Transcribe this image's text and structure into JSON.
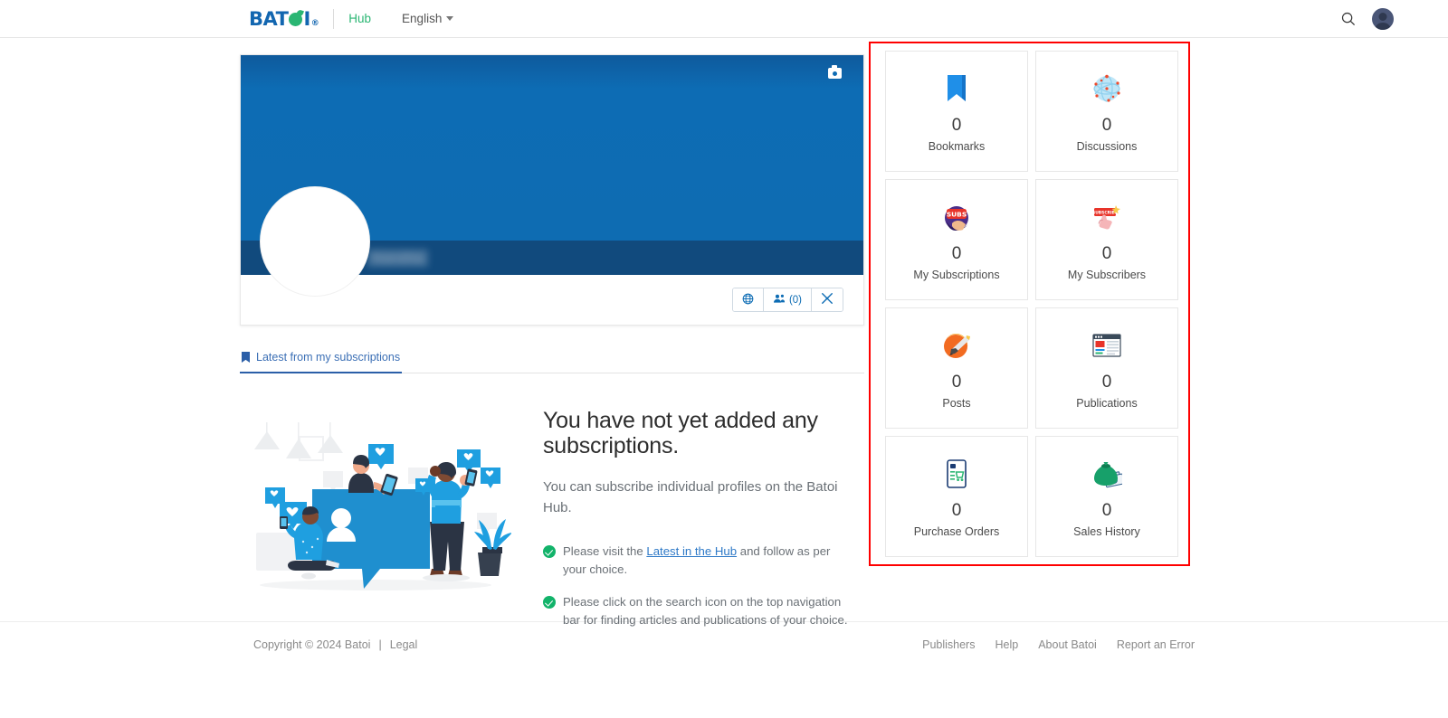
{
  "nav": {
    "brand": "BAT",
    "brand_suffix": "I",
    "brand_reg": "®",
    "hub": "Hub",
    "language": "English",
    "search_icon": "search-icon",
    "avatar_icon": "user-avatar-icon"
  },
  "profile": {
    "username": "Nandita",
    "camera_icon": "camera-icon",
    "actions": {
      "globe_icon": "globe-icon",
      "followers_icon": "people-icon",
      "followers_count": "(0)",
      "tools_icon": "tools-icon"
    }
  },
  "tabs": [
    {
      "label": "Latest from my subscriptions",
      "icon": "bookmark-icon",
      "active": true
    }
  ],
  "empty_state": {
    "heading": "You have not yet added any subscriptions.",
    "paragraph": "You can subscribe individual profiles on the Batoi Hub.",
    "bullets": [
      {
        "pre": "Please visit the ",
        "link": "Latest in the Hub",
        "post": " and follow as per your choice."
      },
      {
        "pre": "Please click on the search icon on the top navigation bar for finding articles and publications of your choice.",
        "link": "",
        "post": ""
      }
    ],
    "illustration": "social-media-engagement-illustration"
  },
  "stats": [
    {
      "value": "0",
      "label": "Bookmarks",
      "icon": "bookmark-icon"
    },
    {
      "value": "0",
      "label": "Discussions",
      "icon": "network-globe-icon"
    },
    {
      "value": "0",
      "label": "My Subscriptions",
      "icon": "subscribe-hand-icon"
    },
    {
      "value": "0",
      "label": "My Subscribers",
      "icon": "subscribe-button-icon"
    },
    {
      "value": "0",
      "label": "Posts",
      "icon": "pen-circle-icon"
    },
    {
      "value": "0",
      "label": "Publications",
      "icon": "document-window-icon"
    },
    {
      "value": "0",
      "label": "Purchase Orders",
      "icon": "mobile-cart-icon"
    },
    {
      "value": "0",
      "label": "Sales History",
      "icon": "money-bag-icon"
    }
  ],
  "footer": {
    "copyright": "Copyright © 2024 Batoi",
    "separator": "|",
    "legal": "Legal",
    "links": [
      "Publishers",
      "Help",
      "About Batoi",
      "Report an Error"
    ]
  },
  "colors": {
    "brand_blue": "#1266b0",
    "brand_green": "#2ab673",
    "banner_blue": "#0d6cb4",
    "namebar_blue": "#114a7d",
    "highlight_red": "#ff0000",
    "link_blue": "#2e79c7",
    "check_green": "#12b36a"
  }
}
